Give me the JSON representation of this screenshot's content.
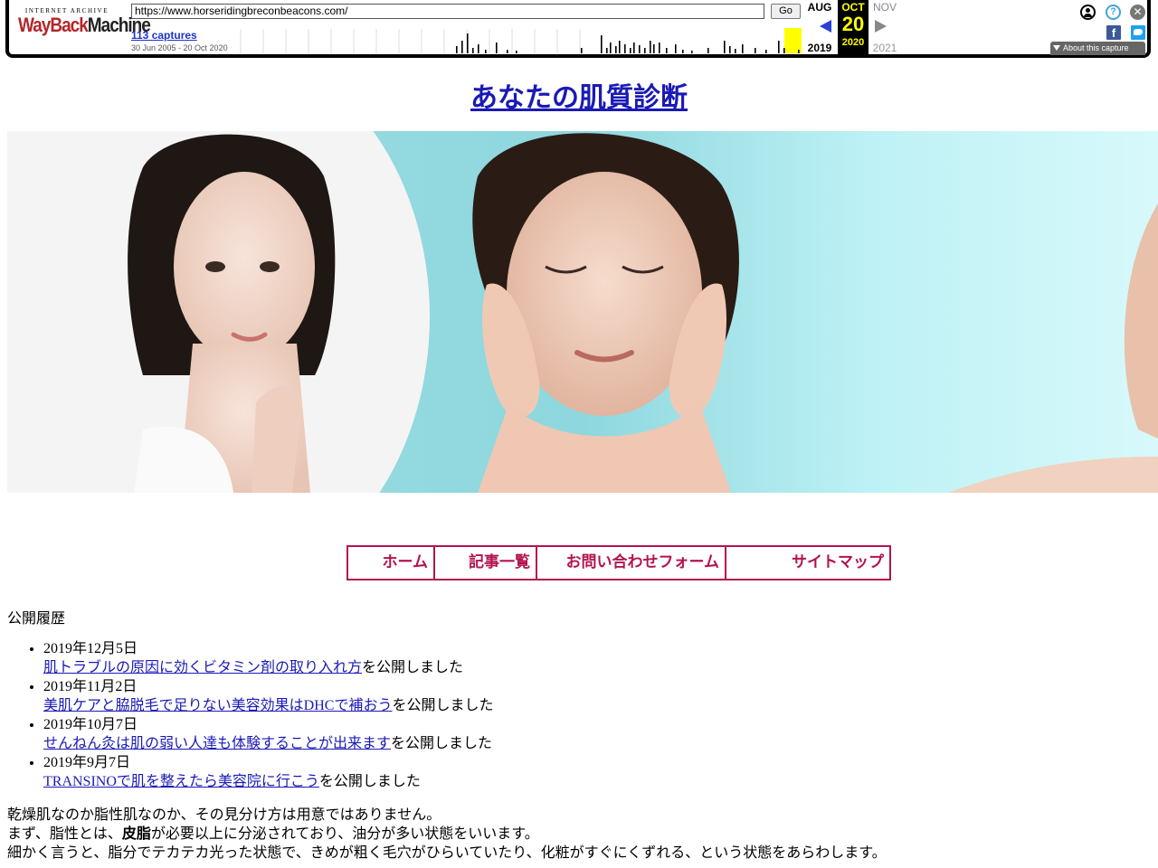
{
  "wayback": {
    "logo_top": "INTERNET ARCHIVE",
    "logo_main_1": "WayBack",
    "logo_main_2": "Machine",
    "url": "https://www.horseridingbreconbeacons.com/",
    "go_label": "Go",
    "captures_label": "113 captures",
    "date_range": "30 Jun 2005 - 20 Oct 2020",
    "prev_month": "AUG",
    "current_month": "OCT",
    "next_month": "NOV",
    "current_day": "20",
    "prev_year": "2019",
    "current_year": "2020",
    "next_year": "2021",
    "about_label": "About this capture",
    "fb_label": "f"
  },
  "page": {
    "title": "あなたの肌質診断",
    "nav": [
      "ホーム",
      "記事一覧",
      "お問い合わせフォーム",
      "サイトマップ"
    ],
    "history_heading": "公開履歴",
    "history": [
      {
        "date": "2019年12月5日",
        "link": "肌トラブルの原因に効くビタミン剤の取り入れ方",
        "suffix": "を公開しました"
      },
      {
        "date": "2019年11月2日",
        "link": "美肌ケアと脇脱毛で足りない美容効果はDHCで補おう",
        "suffix": "を公開しました"
      },
      {
        "date": "2019年10月7日",
        "link": "せんねん灸は肌の弱い人達も体験することが出来ます",
        "suffix": "を公開しました"
      },
      {
        "date": "2019年9月7日",
        "link": "TRANSINOで肌を整えたら美容院に行こう",
        "suffix": "を公開しました"
      }
    ],
    "body_line1": "乾燥肌なのか脂性肌なのか、その見分け方は用意ではありません。",
    "body_line2_pre": "まず、脂性とは、",
    "body_line2_bold": "皮脂",
    "body_line2_post": "が必要以上に分泌されており、油分が多い状態をいいます。",
    "body_line3": "細かく言うと、脂分でテカテカ光った状態で、きめが粗く毛穴がひらいていたり、化粧がすぐにくずれる、という状態をあらわします。"
  },
  "colors": {
    "link": "#1a1ab5",
    "nav_accent": "#b3134f",
    "current_capture": "#ffff00"
  }
}
